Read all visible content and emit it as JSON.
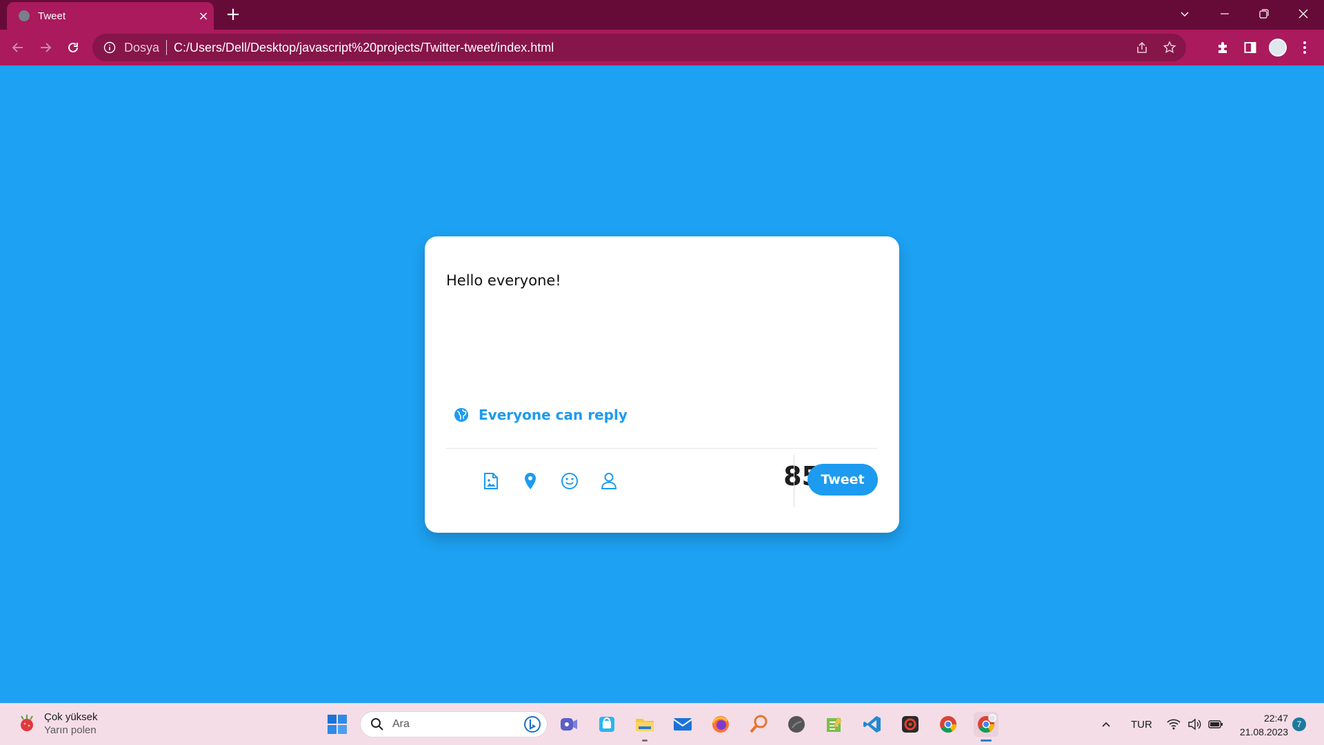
{
  "browser": {
    "tab_title": "Tweet",
    "tab_close": "×",
    "new_tab": "+",
    "address_scheme": "Dosya",
    "address_url": "C:/Users/Dell/Desktop/javascript%20projects/Twitter-tweet/index.html",
    "theme_colors": {
      "tab_strip": "#660b38",
      "toolbar": "#aa1a5d",
      "omnibox": "#86154a"
    }
  },
  "composer": {
    "text": "Hello everyone!",
    "reply_setting": "Everyone can reply",
    "tools": [
      "image-icon",
      "location-icon",
      "emoji-icon",
      "user-icon"
    ],
    "remaining_chars": "85",
    "submit_label": "Tweet",
    "accent_color": "#1d9bf0",
    "background_color": "#1da1f2"
  },
  "taskbar": {
    "weather_title": "Çok yüksek",
    "weather_subtitle": "Yarın polen",
    "search_placeholder": "Ara",
    "language": "TUR",
    "time": "22:47",
    "date": "21.08.2023",
    "notification_count": "7"
  }
}
